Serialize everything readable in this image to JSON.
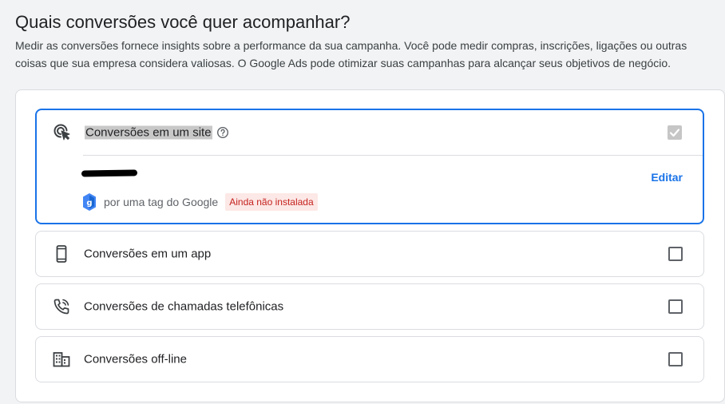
{
  "header": {
    "title": "Quais conversões você quer acompanhar?",
    "description": "Medir as conversões fornece insights sobre a performance da sua campanha. Você pode medir compras, inscrições, ligações ou outras coisas que sua empresa considera valiosas. O Google Ads pode otimizar suas campanhas para alcançar seus objetivos de negócio."
  },
  "options": [
    {
      "label": "Conversões em um site",
      "icon": "cursor-click-icon",
      "checked": true,
      "details": {
        "edit_label": "Editar",
        "method_text": "por uma tag do Google",
        "status_badge": "Ainda não instalada"
      }
    },
    {
      "label": "Conversões em um app",
      "icon": "phone-icon",
      "checked": false
    },
    {
      "label": "Conversões de chamadas telefônicas",
      "icon": "phone-call-icon",
      "checked": false
    },
    {
      "label": "Conversões off-line",
      "icon": "building-icon",
      "checked": false
    }
  ],
  "colors": {
    "accent": "#1a73e8",
    "warning_bg": "#fce8e6",
    "warning_text": "#c5221f"
  }
}
